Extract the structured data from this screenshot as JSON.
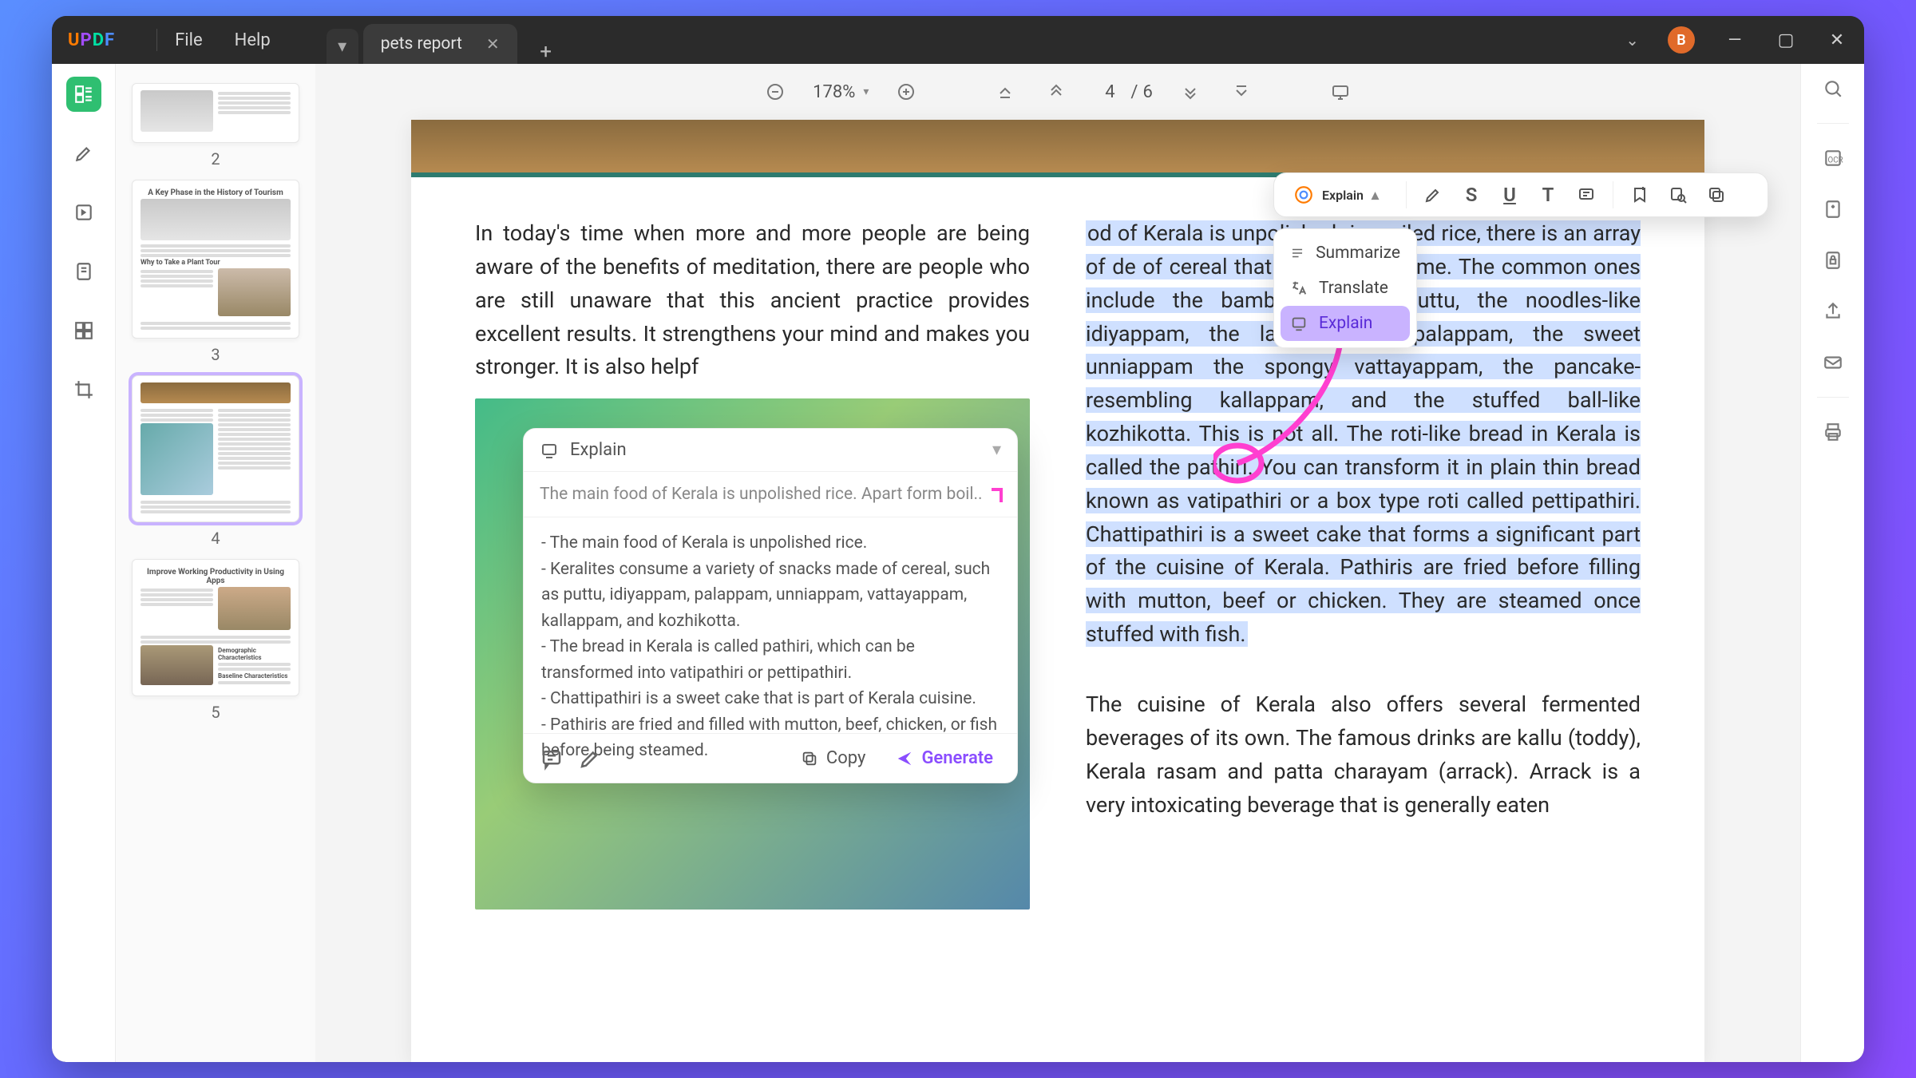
{
  "app": {
    "logo": [
      "U",
      "P",
      "D",
      "F"
    ]
  },
  "menu": {
    "file": "File",
    "help": "Help"
  },
  "tab": {
    "title": "pets report"
  },
  "toolbar": {
    "zoom_value": "178%",
    "page_current": "4",
    "page_sep": "/",
    "page_total": "6"
  },
  "avatar": {
    "initial": "B"
  },
  "thumbs": {
    "n2": "2",
    "n3": "3",
    "n4": "4",
    "n5": "5",
    "t3_title": "A Key Phase in the History of Tourism",
    "t3_sub": "Why to Take a Plant Tour",
    "t5_title": "Improve Working Productivity in Using Apps",
    "t5_sub1": "Demographic Characteristics",
    "t5_sub2": "Baseline Characteristics"
  },
  "page": {
    "left_para": "In today's time when more and more people are being aware of the benefits of meditation, there are people who are still unaware that this ancient practice provides excellent results. It strengthens your mind and makes you stronger. It is also helpf",
    "right_hl": "od of Kerala is unpolished rice. oiled rice, there is an array of de of cereal that Keralites onsume. The common ones include the bamboo formed puttu, the noodles-like idiyappam, the lace rimmed palappam, the sweet unniappam the spongy vattayappam, the pancake-resembling kallappam, and the stuffed ball-like kozhikotta. This is not all. The roti-like bread in Kerala is called the pathiri. You can transform it in plain thin bread known as vatipathiri or a box type roti called pettipathiri. Chattipathiri is a sweet cake that forms a significant part of the cuisine of Kerala. Pathiris are fried before filling with mutton, beef or chicken. They are steamed once stuffed with fish.",
    "right_rest": "The cuisine of Kerala also offers several fermented beverages of its own. The famous drinks are kallu (toddy), Kerala rasam and patta charayam (arrack). Arrack is a very intoxicating beverage that is generally eaten"
  },
  "ctx": {
    "explain": "Explain"
  },
  "dd": {
    "summarize": "Summarize",
    "translate": "Translate",
    "explain": "Explain"
  },
  "ai": {
    "head": "Explain",
    "src": "The main food of Kerala is unpolished rice. Apart form boil..",
    "b1": "- The main food of Kerala is unpolished rice.",
    "b2": "- Keralites consume a variety of snacks made of cereal, such as puttu, idiyappam, palappam, unniappam, vattayappam, kallappam, and kozhikotta.",
    "b3": "- The bread in Kerala is called pathiri, which can be transformed into vatipathiri or pettipathiri.",
    "b4": "- Chattipathiri is a sweet cake that is part of Kerala cuisine.",
    "b5": "- Pathiris are fried and filled with mutton, beef, chicken, or fish before being steamed.",
    "copy": "Copy",
    "generate": "Generate"
  }
}
